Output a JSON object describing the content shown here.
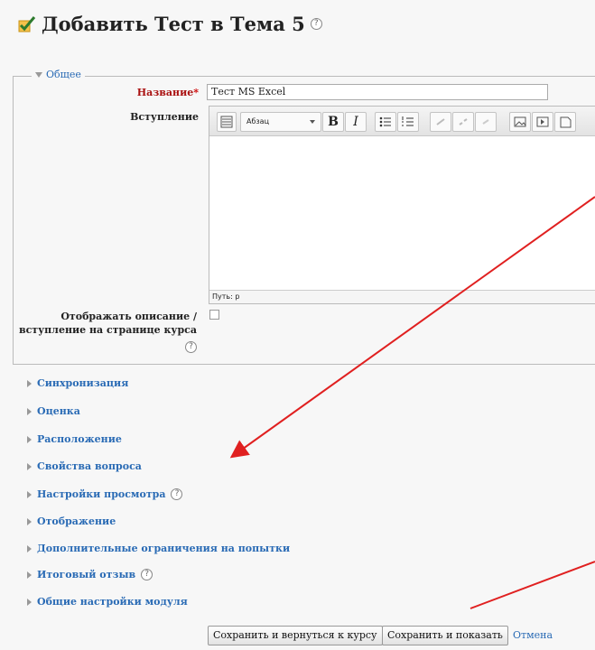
{
  "page_title": "Добавить Тест в Тема 5",
  "help_glyph": "?",
  "legend": "Общее",
  "fields": {
    "name_label": "Название",
    "required_mark": "*",
    "name_value": "Тест MS Excel",
    "intro_label": "Вступление",
    "show_desc_label_line1": "Отображать описание /",
    "show_desc_label_line2": "вступление на странице курса"
  },
  "editor": {
    "format_select": "Абзац",
    "bold": "B",
    "italic": "I",
    "status_path": "Путь: p"
  },
  "sections": [
    {
      "label": "Синхронизация"
    },
    {
      "label": "Оценка"
    },
    {
      "label": "Расположение"
    },
    {
      "label": "Свойства вопроса"
    },
    {
      "label": "Настройки просмотра"
    },
    {
      "label": "Отображение"
    },
    {
      "label": "Дополнительные ограничения на попытки"
    },
    {
      "label": "Итоговый отзыв"
    },
    {
      "label": "Общие настройки модуля"
    }
  ],
  "buttons": {
    "save_return": "Сохранить и вернуться к курсу",
    "save_show": "Сохранить и показать",
    "cancel": "Отмена"
  },
  "colors": {
    "link": "#2a6bb5",
    "required": "#a11",
    "arrow": "#e02020"
  }
}
